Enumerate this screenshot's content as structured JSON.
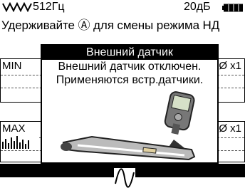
{
  "status": {
    "frequency": "512Гц",
    "gain": "20дБ",
    "wave_icon": "triple-sine-wave-icon",
    "battery_icon": "battery-icon"
  },
  "hint": "Удерживайте Ⓐ для смены режима НД",
  "panels": {
    "min_label": "MIN",
    "min_right": "Ø x1",
    "max_label": "MAX",
    "max_right": "Ø x1"
  },
  "dialog": {
    "title": "Внешний датчик",
    "line1": "Внешний датчик отключен.",
    "line2": "Применяются встр.датчики.",
    "image": "locator-device-illustration"
  },
  "bottom": {
    "mode_icon": "sine-wave-mode-icon"
  }
}
